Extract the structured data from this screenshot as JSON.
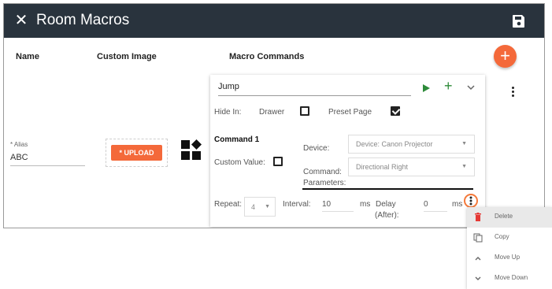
{
  "header": {
    "title": "Room Macros",
    "close_icon": "close-icon",
    "save_icon": "save-icon"
  },
  "columns": {
    "name": "Name",
    "custom_image": "Custom Image",
    "macro_commands": "Macro Commands"
  },
  "add_button": {
    "icon": "plus-icon",
    "label": "+"
  },
  "alias": {
    "label": "* Alias",
    "value": "ABC"
  },
  "upload": {
    "label": "* UPLOAD"
  },
  "macro": {
    "name": "Jump",
    "hide_in_label": "Hide In:",
    "drawer_label": "Drawer",
    "drawer_checked": false,
    "preset_page_label": "Preset Page",
    "preset_page_checked": true
  },
  "command": {
    "title": "Command 1",
    "custom_value_label": "Custom Value:",
    "custom_value_checked": false,
    "device_label": "Device:",
    "device_value": "Device: Canon Projector",
    "command_label": "Command:",
    "command_value": "Directional Right",
    "parameters_label": "Parameters:",
    "repeat_label": "Repeat:",
    "repeat_value": "4",
    "interval_label": "Interval:",
    "interval_value": "10",
    "interval_unit": "ms",
    "delay_label": "Delay",
    "delay_after_label": "(After):",
    "delay_value": "0",
    "delay_unit": "ms"
  },
  "context_menu": {
    "items": [
      {
        "label": "Delete",
        "icon": "trash-icon"
      },
      {
        "label": "Copy",
        "icon": "copy-icon"
      },
      {
        "label": "Move Up",
        "icon": "chevron-up-icon"
      },
      {
        "label": "Move Down",
        "icon": "chevron-down-icon"
      }
    ]
  },
  "colors": {
    "header_bg": "#29333d",
    "accent": "#f4693a",
    "green": "#2e8b3a",
    "delete_red": "#e53935"
  }
}
